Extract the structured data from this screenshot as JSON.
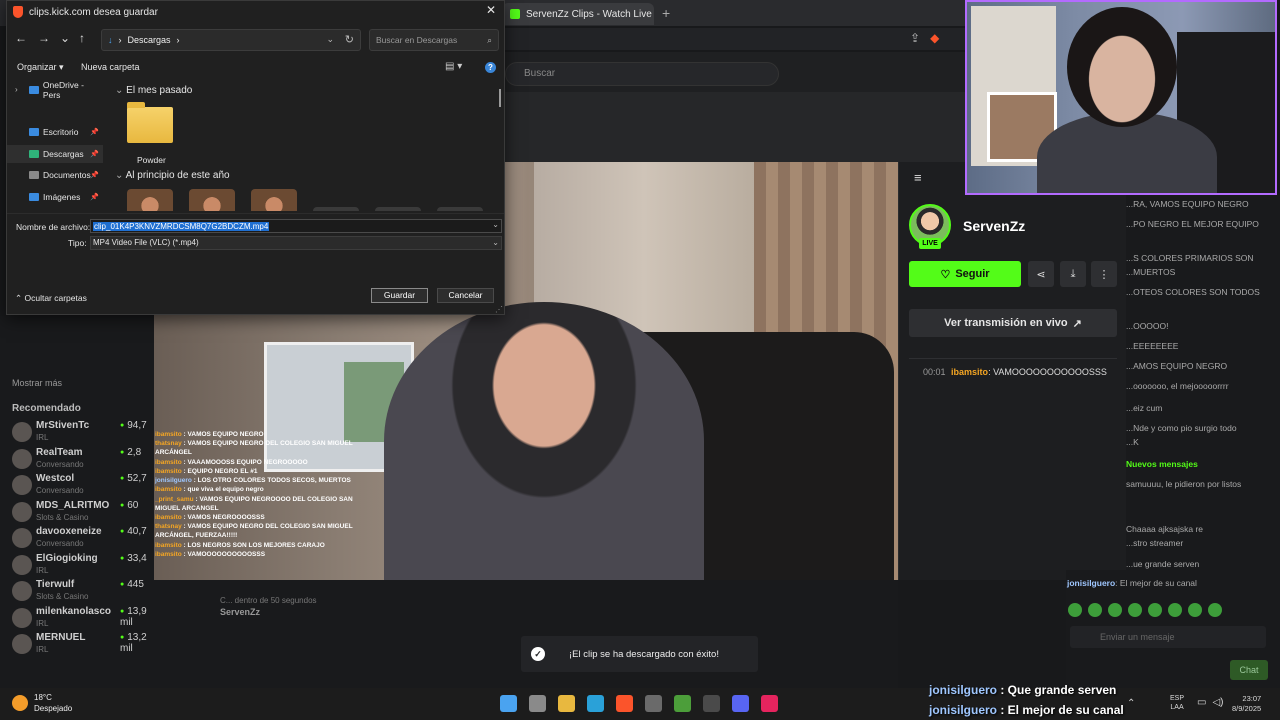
{
  "browser": {
    "tab_title": "ServenZz Clips - Watch Live on K",
    "new_tab": "+",
    "kick_search_placeholder": "Buscar"
  },
  "dialog": {
    "title": "clips.kick.com desea guardar",
    "close": "✕",
    "back": "←",
    "forward": "→",
    "recent": "⌄",
    "up": "↑",
    "address": "Descargas",
    "search_placeholder": "Buscar en Descargas",
    "organize": "Organizar ▾",
    "new_folder": "Nueva carpeta",
    "nav_items": [
      {
        "label": "OneDrive - Pers",
        "color": "#3a8be0"
      },
      {
        "label": "Escritorio",
        "color": "#3a8be0"
      },
      {
        "label": "Descargas",
        "color": "#2fb37a"
      },
      {
        "label": "Documentos",
        "color": "#8a8a8a"
      },
      {
        "label": "Imágenes",
        "color": "#3a8be0"
      }
    ],
    "group_last_month": "El mes pasado",
    "folder_name": "Powder",
    "group_start_year": "Al principio de este año",
    "filename_label": "Nombre de archivo:",
    "filename_value": "clip_01K4P3KNVZMRDCSM8Q7G2BDCZM.mp4",
    "type_label": "Tipo:",
    "type_value": "MP4 Video File (VLC) (*.mp4)",
    "hide_folders": "Ocultar carpetas",
    "save_label": "Guardar",
    "cancel_label": "Cancelar"
  },
  "left_sidebar": {
    "show_more": "Mostrar más",
    "recommended_title": "Recomendado",
    "items": [
      {
        "name": "MrStivenTc",
        "category": "IRL",
        "viewers": "94,7"
      },
      {
        "name": "RealTeam",
        "category": "Conversando",
        "viewers": "2,8"
      },
      {
        "name": "Westcol",
        "category": "Conversando",
        "viewers": "52,7"
      },
      {
        "name": "MDS_ALRITMO",
        "category": "Slots & Casino",
        "viewers": "60"
      },
      {
        "name": "davooxeneize",
        "category": "Conversando",
        "viewers": "40,7"
      },
      {
        "name": "ElGiogioking",
        "category": "IRL",
        "viewers": "33,4"
      },
      {
        "name": "Tierwulf",
        "category": "Slots & Casino",
        "viewers": "445"
      },
      {
        "name": "milenkanolasco",
        "category": "IRL",
        "viewers": "13,9 mil"
      },
      {
        "name": "MERNUEL",
        "category": "IRL",
        "viewers": "13,2 mil"
      }
    ]
  },
  "clip_chat": [
    {
      "user": "ibamsito",
      "text": "VAMOS EQUIPO NEGRO",
      "alt": false
    },
    {
      "user": "thatsnay",
      "text": "VAMOS EQUIPO NEGRO DEL COLEGIO SAN MIGUEL ARCÁNGEL",
      "alt": false
    },
    {
      "user": "ibamsito",
      "text": "VAAAMOOOSS EQUIPO NEGROOOOO",
      "alt": false
    },
    {
      "user": "ibamsito",
      "text": "EQUIPO NEGRO EL #1",
      "alt": false
    },
    {
      "user": "jonisilguero",
      "text": "LOS OTRO COLORES TODOS SECOS, MUERTOS",
      "alt": true
    },
    {
      "user": "ibamsito",
      "text": "que viva el equipo negro",
      "alt": false
    },
    {
      "user": "_print_samu",
      "text": "VAMOS EQUIPO NEGROOOO DEL COLEGIO SAN MIGUEL ARCANGEL",
      "alt": false
    },
    {
      "user": "ibamsito",
      "text": "VAMOS NEGROOOOSSS",
      "alt": false
    },
    {
      "user": "thatsnay",
      "text": "VAMOS EQUIPO NEGRO DEL COLEGIO SAN MIGUEL ARCÁNGEL, FUERZAA!!!!!",
      "alt": false
    },
    {
      "user": "ibamsito",
      "text": "LOS NEGROS SON LOS MEJORES CARAJO",
      "alt": false
    },
    {
      "user": "ibamsito",
      "text": "VAMOOOOOOOOOOSSS",
      "alt": false
    }
  ],
  "under_video": {
    "line1": "",
    "line2": "C... dentro de 50 segundos",
    "line3": "ServenZz"
  },
  "clip_panel": {
    "menu_icon": "≡",
    "live_badge": "LIVE",
    "streamer": "ServenZz",
    "follow": "Seguir",
    "watch_live": "Ver transmisión en vivo",
    "chat_time": "00:01",
    "chat_user": "ibamsito",
    "chat_text": "VAMOOOOOOOOOOOSSS"
  },
  "right_chat": {
    "lines": [
      "...RA, VAMOS EQUIPO NEGRO",
      "...PO NEGRO EL MEJOR EQUIPO",
      "...S COLORES PRIMARIOS SON",
      "...MUERTOS",
      "...OTEOS COLORES SON TODOS",
      "...OOOOO!",
      "...EEEEEEEE",
      "...AMOS EQUIPO NEGRO",
      "...ooooooo, el mejooooorrrr",
      "...eiz cum",
      "...Nde y como pio surgio todo",
      "...K"
    ],
    "new_messages": "Nuevos mensajes",
    "lines2": [
      "samuuuu, le pidieron por listos",
      "Chaaaa ajksajska re",
      "...stro streamer",
      "...ue grande serven"
    ],
    "last_user": "jonisilguero",
    "last_text": ": El mejor de su canal",
    "input_placeholder": "Enviar un mensaje",
    "send": "Chat"
  },
  "toast": {
    "message": "¡El clip se ha descargado con éxito!"
  },
  "overlay_chat": [
    {
      "user": "jonisilguero",
      "text": " : Que grande serven"
    },
    {
      "user": "jonisilguero",
      "text": " : El mejor de su canal"
    }
  ],
  "taskbar": {
    "temp": "18°C",
    "weather": "Despejado",
    "lang1": "ESP",
    "lang2": "LAA",
    "time": "23:07",
    "date": "8/9/2025",
    "icons": [
      {
        "name": "start",
        "color": "#4aa3f0"
      },
      {
        "name": "task-view",
        "color": "#8a8a8a"
      },
      {
        "name": "file-explorer",
        "color": "#e8b83f"
      },
      {
        "name": "edge",
        "color": "#2aa1d8"
      },
      {
        "name": "brave",
        "color": "#fb542b"
      },
      {
        "name": "obs",
        "color": "#6a6a6a"
      },
      {
        "name": "minecraft",
        "color": "#4c9e3a"
      },
      {
        "name": "steam",
        "color": "#4a4a4a"
      },
      {
        "name": "discord",
        "color": "#5865f2"
      },
      {
        "name": "tiktok",
        "color": "#e5245e"
      }
    ]
  }
}
